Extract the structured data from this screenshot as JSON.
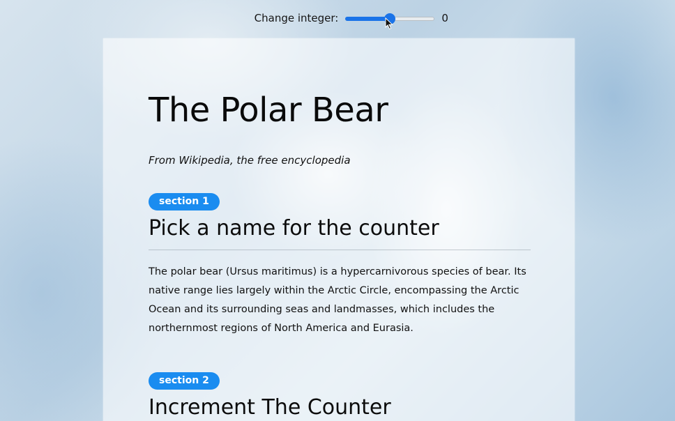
{
  "controls": {
    "label": "Change integer:",
    "value": "0",
    "slider_fraction": 0.5,
    "accent_color": "#1a73e8"
  },
  "article": {
    "title": "The Polar Bear",
    "subtitle": "From Wikipedia, the free encyclopedia",
    "sections": [
      {
        "badge": "section 1",
        "title": "Pick a name for the counter",
        "body": "The polar bear (Ursus maritimus) is a hypercarnivorous species of bear. Its native range lies largely within the Arctic Circle, encompassing the Arctic Ocean and its surrounding seas and landmasses, which includes the northernmost regions of North America and Eurasia."
      },
      {
        "badge": "section 2",
        "title": "Increment The Counter"
      }
    ],
    "badge_color": "#1a8cf0"
  }
}
